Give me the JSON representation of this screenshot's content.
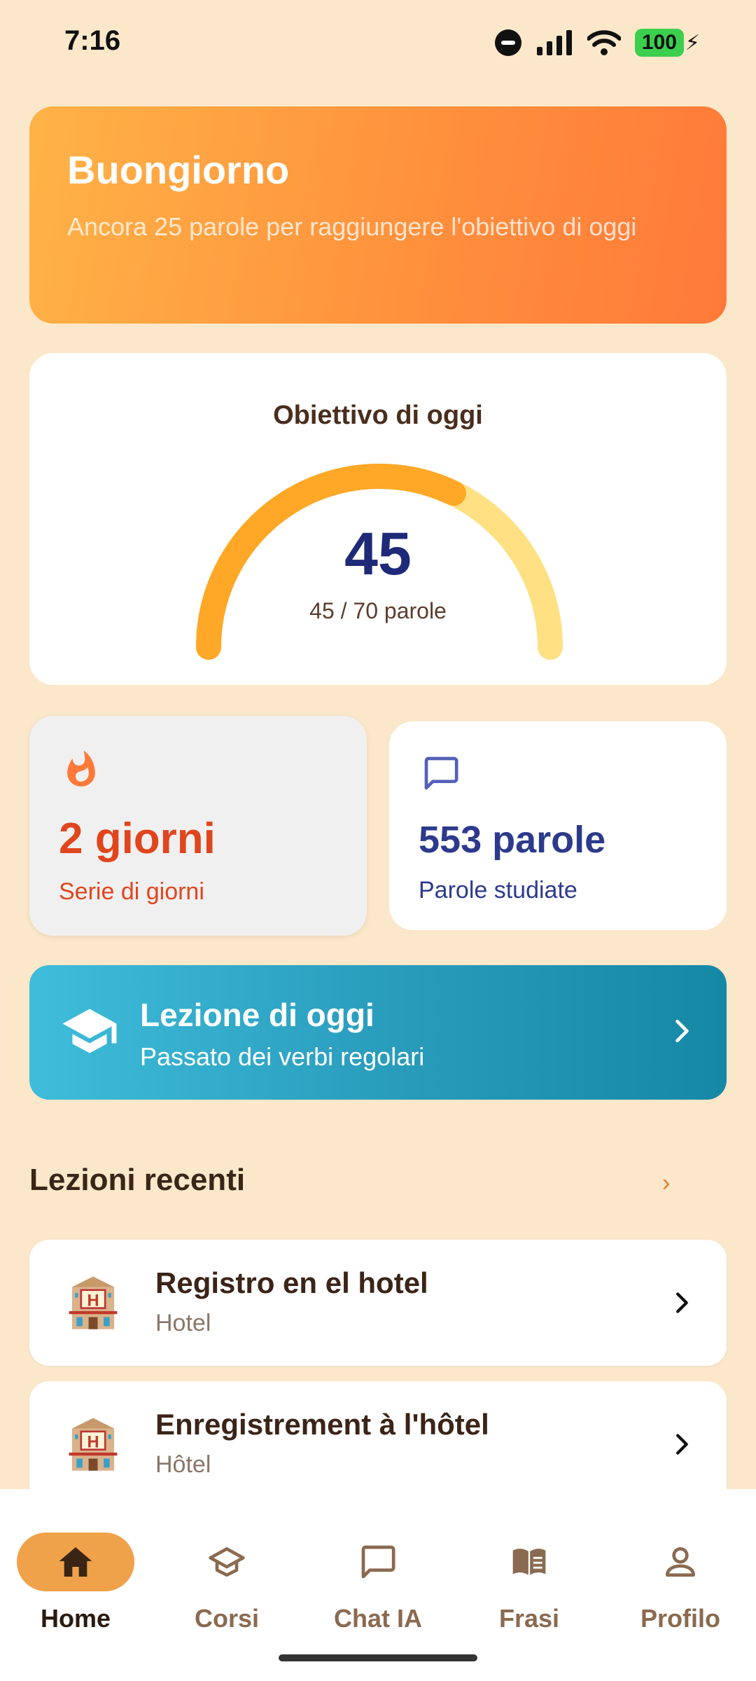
{
  "status_bar": {
    "time": "7:16",
    "battery": "100"
  },
  "greeting": {
    "title": "Buongiorno",
    "subtitle": "Ancora 25 parole per raggiungere l'obiettivo di oggi"
  },
  "goal": {
    "title": "Obiettivo di oggi",
    "value": "45",
    "progress_text": "45 / 70 parole",
    "progress_fraction": 0.643,
    "colors": {
      "filled": "#ffa726",
      "track": "#ffe082"
    }
  },
  "stats": {
    "streak": {
      "value": "2 giorni",
      "label": "Serie di giorni",
      "icon": "fire-icon",
      "color": "#e0461e"
    },
    "words": {
      "value": "553 parole",
      "label": "Parole studiate",
      "icon": "chat-bubble-icon",
      "color": "#2d3a8c"
    }
  },
  "lesson_of_day": {
    "title": "Lezione di oggi",
    "subtitle": "Passato dei verbi regolari",
    "icon": "graduation-cap-icon"
  },
  "recent": {
    "title": "Lezioni recenti",
    "more": "›",
    "items": [
      {
        "title": "Registro en el hotel",
        "subtitle": "Hotel",
        "icon": "hotel-emoji"
      },
      {
        "title": "Enregistrement à l'hôtel",
        "subtitle": "Hôtel",
        "icon": "hotel-emoji"
      }
    ]
  },
  "nav": {
    "items": [
      {
        "label": "Home",
        "icon": "home-icon",
        "active": true
      },
      {
        "label": "Corsi",
        "icon": "school-icon"
      },
      {
        "label": "Chat IA",
        "icon": "chat-icon"
      },
      {
        "label": "Frasi",
        "icon": "book-icon"
      },
      {
        "label": "Profilo",
        "icon": "person-icon"
      }
    ]
  }
}
